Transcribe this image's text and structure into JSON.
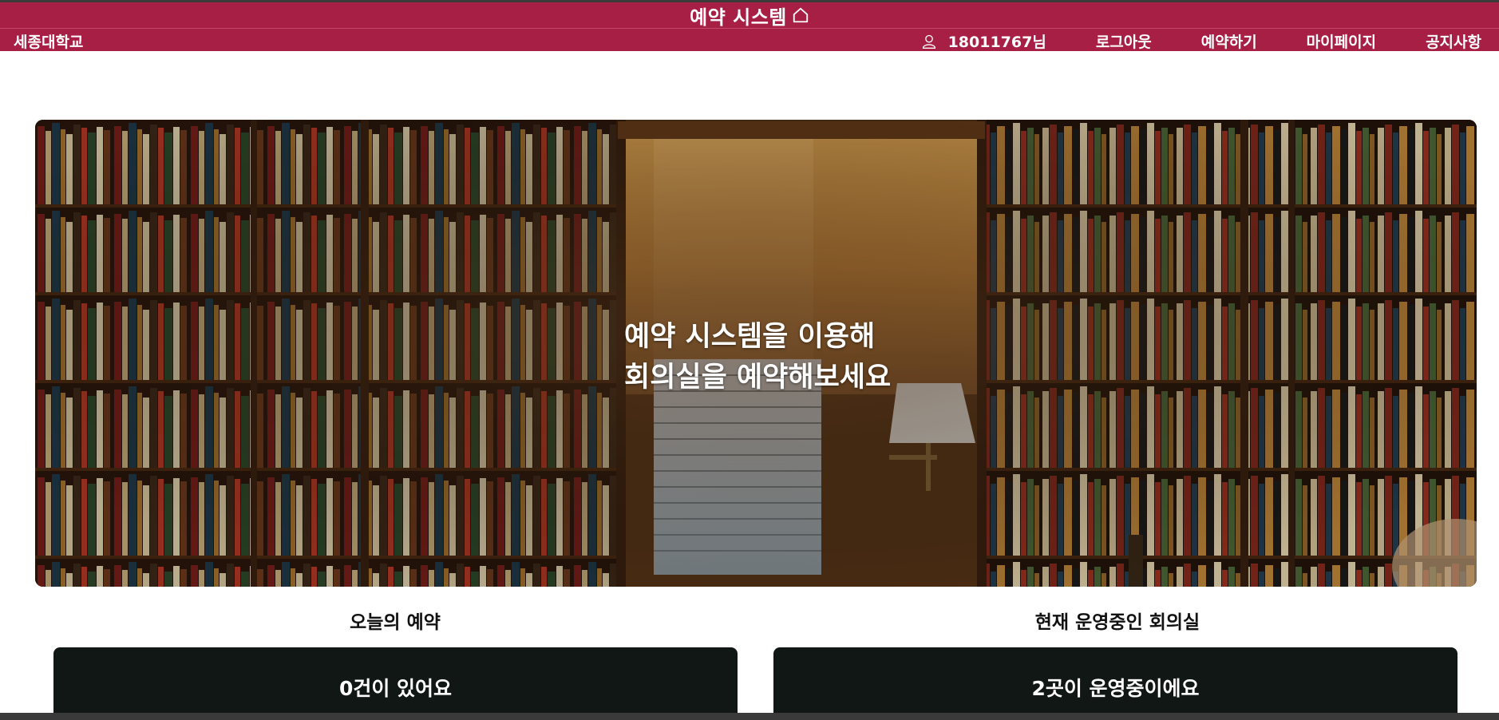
{
  "header": {
    "site_title": "예약 시스템",
    "brand": "세종대학교",
    "user_label": "18011767님",
    "nav": {
      "logout": "로그아웃",
      "reserve": "예약하기",
      "mypage": "마이페이지",
      "notice": "공지사항"
    },
    "colors": {
      "bar": "#a81f45"
    },
    "icons": {
      "home": "home-icon",
      "user": "user-icon"
    }
  },
  "hero": {
    "line1": "예약 시스템을 이용해",
    "line2": "회의실을 예약해보세요"
  },
  "sections": {
    "today": {
      "title": "오늘의 예약",
      "summary": "0건이 있어요"
    },
    "rooms": {
      "title": "현재 운영중인 회의실",
      "summary": "2곳이 운영중이에요"
    }
  }
}
